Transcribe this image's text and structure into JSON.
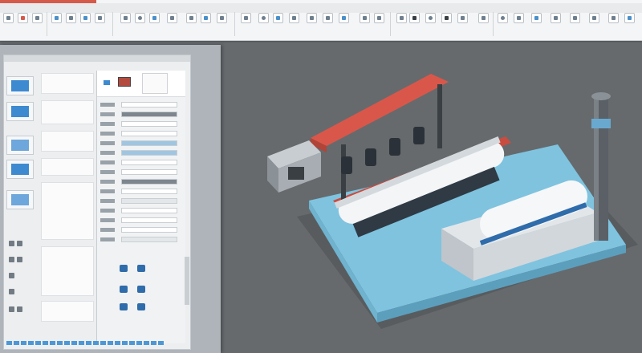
{
  "window": {
    "title": ""
  },
  "ribbon": {
    "tabs": [
      "",
      "",
      "",
      "",
      "",
      "",
      "",
      ""
    ],
    "status": ""
  },
  "colors": {
    "ribbon_accent": "#d65a4a",
    "canvas_bg": "#666a6d",
    "platform": "#7fc3df",
    "roller": "#f3f5f7",
    "beam": "#d9574a",
    "thumbnail_blue": "#3e8ad0"
  },
  "icons": [
    "document-icon",
    "save-icon",
    "undo-icon",
    "redo-icon",
    "paint-icon",
    "text-icon",
    "shape-icon",
    "insert-icon",
    "gear-icon",
    "lock-icon",
    "view-icon",
    "help-icon"
  ],
  "doc_window": {
    "title": ""
  },
  "thumbnails": [
    {
      "num": ""
    },
    {
      "num": ""
    },
    {
      "num": ""
    },
    {
      "num": ""
    },
    {
      "num": ""
    }
  ],
  "scene": {
    "description_visible": false
  }
}
